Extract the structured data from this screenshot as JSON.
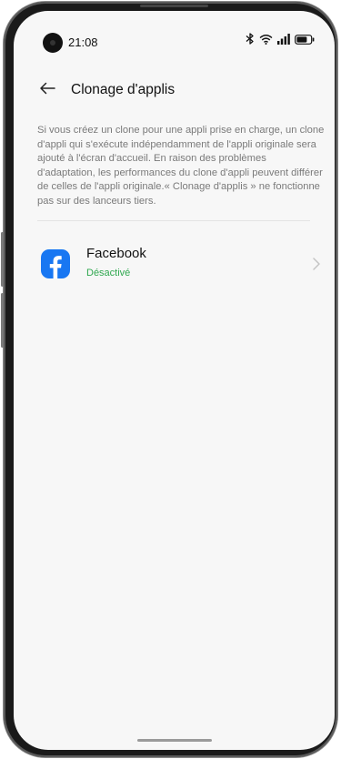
{
  "status_bar": {
    "time": "21:08",
    "icons": [
      "bluetooth-icon",
      "wifi-icon",
      "signal-icon",
      "battery-icon"
    ]
  },
  "header": {
    "title": "Clonage d'applis",
    "back_icon": "arrow-left-icon"
  },
  "description": "Si vous créez un clone pour une appli prise en charge, un clone d'appli qui s'exécute indépendamment de l'appli originale sera ajouté à l'écran d'accueil. En raison des problèmes d'adaptation, les performances du clone d'appli peuvent différer de celles de l'appli originale.« Clonage d'applis » ne fonctionne pas sur des lanceurs tiers.",
  "apps": [
    {
      "name": "Facebook",
      "status": "Désactivé",
      "icon": "facebook-icon"
    }
  ],
  "colors": {
    "background": "#f7f7f7",
    "status_on": "#2fa84f",
    "facebook_blue": "#1877f2",
    "text_secondary": "#7a7a7a"
  }
}
